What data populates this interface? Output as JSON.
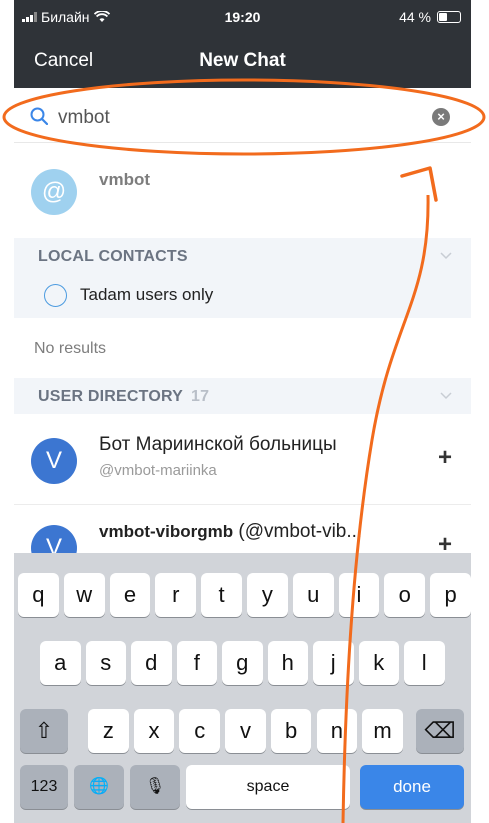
{
  "status": {
    "carrier": "Билайн",
    "time": "19:20",
    "battery": "44 %",
    "battery_level": 0.44
  },
  "nav": {
    "cancel": "Cancel",
    "title": "New Chat"
  },
  "search": {
    "value": "vmbot"
  },
  "mxid_result": {
    "avatar": "@",
    "name": "vmbot"
  },
  "local_contacts": {
    "header": "LOCAL CONTACTS",
    "filter_label": "Tadam users only",
    "no_results": "No results"
  },
  "user_directory": {
    "header": "USER DIRECTORY",
    "count": "17",
    "items": [
      {
        "initial": "V",
        "name": "Бот Мариинской больницы",
        "id": "@vmbot-mariinka"
      },
      {
        "initial": "V",
        "name_bold": "vmbot-viborgmb",
        "name_rest": " (@vmbot-vib...",
        "id": ""
      }
    ]
  },
  "keyboard": {
    "row1": [
      "q",
      "w",
      "e",
      "r",
      "t",
      "y",
      "u",
      "i",
      "o",
      "p"
    ],
    "row2": [
      "a",
      "s",
      "d",
      "f",
      "g",
      "h",
      "j",
      "k",
      "l"
    ],
    "row3": [
      "z",
      "x",
      "c",
      "v",
      "b",
      "n",
      "m"
    ],
    "numbers": "123",
    "space": "space",
    "done": "done",
    "shift": "⇧",
    "backspace": "⌫",
    "globe": "🌐",
    "mic": "🎙"
  },
  "colors": {
    "annotation": "#f26b1d",
    "header_bg": "#2f3338",
    "accent": "#3a86e8"
  }
}
